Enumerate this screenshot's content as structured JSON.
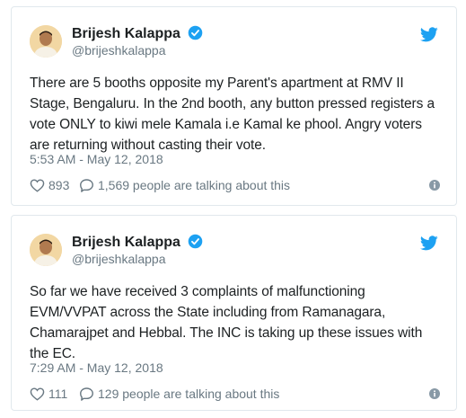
{
  "colors": {
    "text": "#1c2022",
    "secondary": "#697882",
    "twitter_blue": "#1da1f2",
    "border": "#e1e8ed"
  },
  "tweets": [
    {
      "author": {
        "name": "Brijesh Kalappa",
        "handle": "@brijeshkalappa",
        "verified": true
      },
      "text": "There are 5 booths opposite my Parent's apartment at RMV II Stage, Bengaluru. In the 2nd booth, any button pressed registers a vote ONLY to kiwi mele Kamala i.e Kamal ke phool. Angry voters are returning without casting their vote.",
      "timestamp": "5:53 AM - May 12, 2018",
      "likes": "893",
      "talking": "1,569 people are talking about this"
    },
    {
      "author": {
        "name": "Brijesh Kalappa",
        "handle": "@brijeshkalappa",
        "verified": true
      },
      "text": "So far we have received 3 complaints of malfunctioning EVM/VVPAT across the State including from Ramanagara, Chamarajpet and Hebbal. The INC is taking up these issues with the EC.",
      "timestamp": "7:29 AM - May 12, 2018",
      "likes": "111",
      "talking": "129 people are talking about this"
    }
  ]
}
